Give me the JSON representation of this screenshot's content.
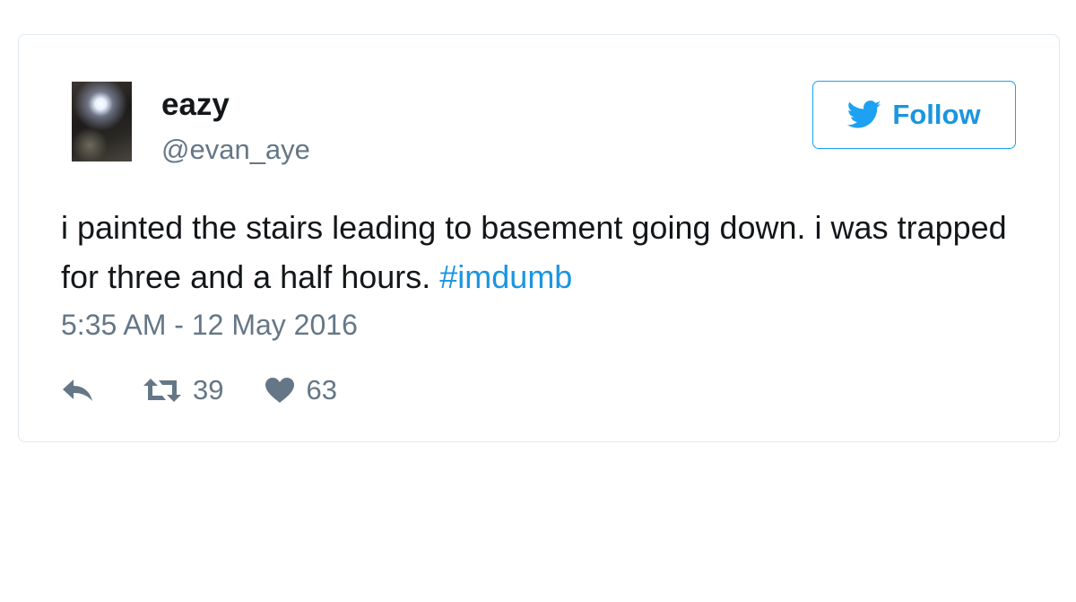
{
  "user": {
    "name": "eazy",
    "handle": "@evan_aye",
    "avatar_icon": "profile-photo"
  },
  "follow": {
    "label": "Follow",
    "icon": "twitter-bird-icon",
    "color": "#1da1f2"
  },
  "tweet": {
    "text": "i painted the stairs leading to basement going down. i was trapped for three and a half hours. ",
    "hashtag": "#imdumb",
    "timestamp": "5:35 AM - 12 May 2016"
  },
  "actions": {
    "reply_icon": "reply-icon",
    "retweet_icon": "retweet-icon",
    "retweet_count": "39",
    "like_icon": "heart-icon",
    "like_count": "63"
  },
  "colors": {
    "text": "#14171a",
    "secondary": "#657786",
    "link": "#1b95e0",
    "border": "#e1e8ed"
  }
}
